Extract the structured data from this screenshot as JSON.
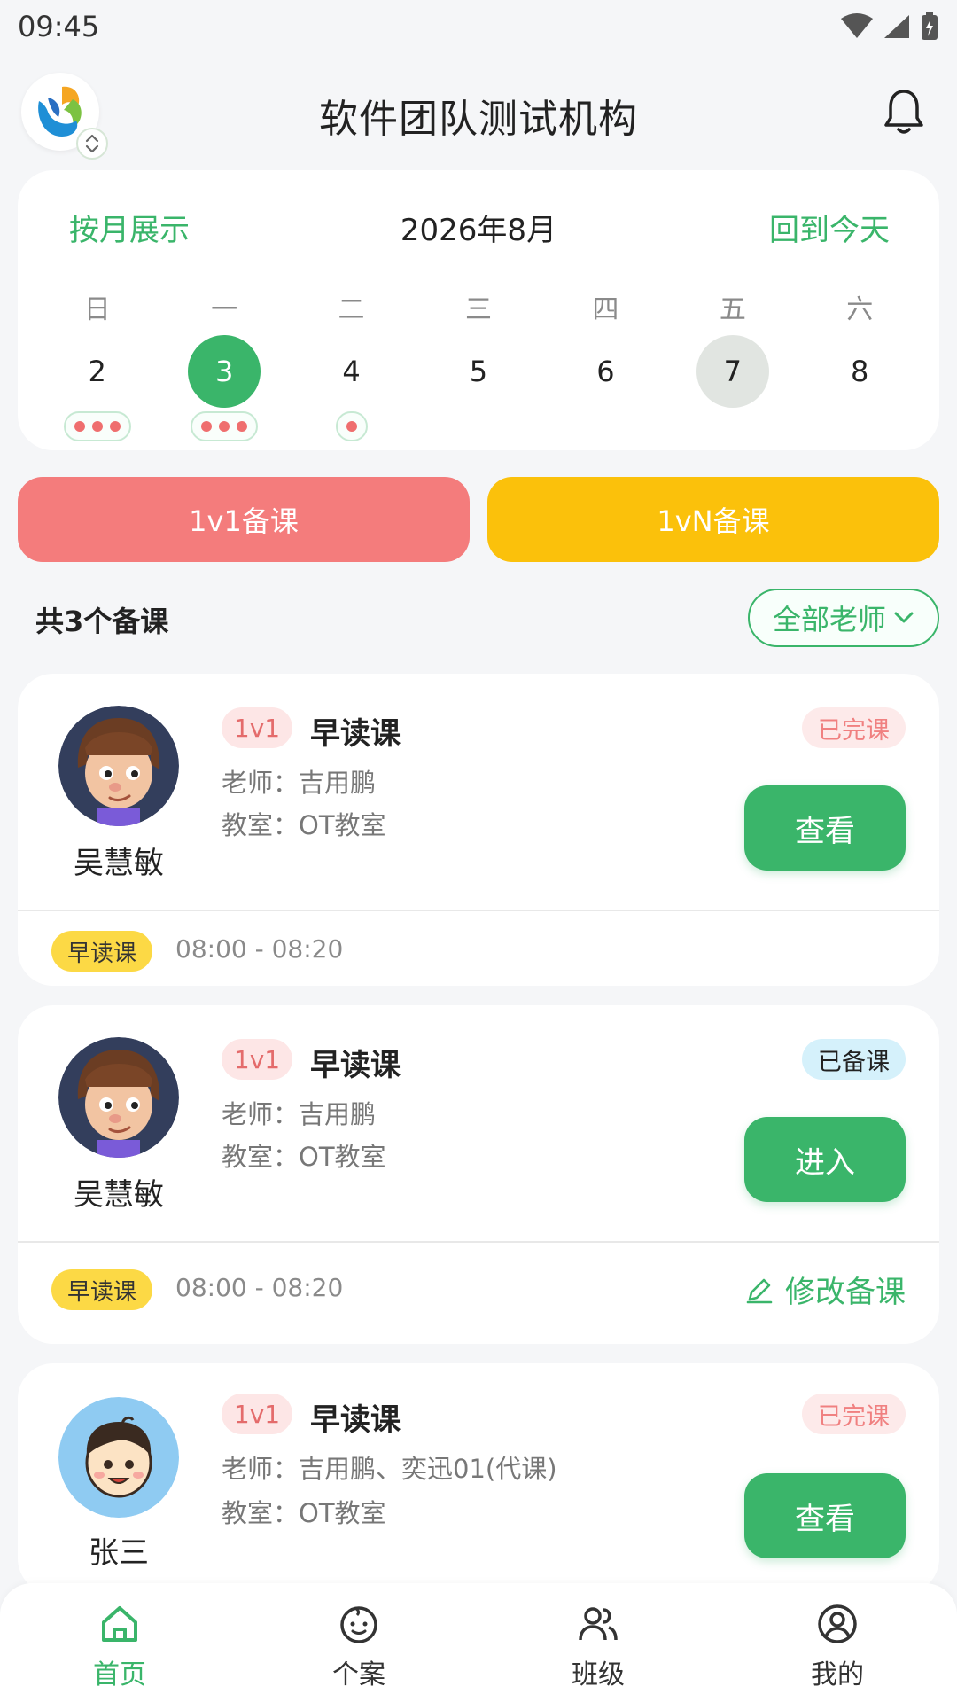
{
  "status_bar": {
    "time": "09:45"
  },
  "header": {
    "org_name": "软件团队测试机构"
  },
  "calendar": {
    "mode_label": "按月展示",
    "title": "2026年8月",
    "today_label": "回到今天",
    "days": [
      {
        "weekday": "日",
        "date": "2",
        "dot_count": 3,
        "state": ""
      },
      {
        "weekday": "一",
        "date": "3",
        "dot_count": 3,
        "state": "selected"
      },
      {
        "weekday": "二",
        "date": "4",
        "dot_count": 1,
        "state": ""
      },
      {
        "weekday": "三",
        "date": "5",
        "dot_count": 0,
        "state": ""
      },
      {
        "weekday": "四",
        "date": "6",
        "dot_count": 0,
        "state": ""
      },
      {
        "weekday": "五",
        "date": "7",
        "dot_count": 0,
        "state": "today"
      },
      {
        "weekday": "六",
        "date": "8",
        "dot_count": 0,
        "state": ""
      }
    ]
  },
  "prep_buttons": {
    "one_on_one": "1v1备课",
    "one_on_n": "1vN备课"
  },
  "summary": {
    "count_text": "共3个备课",
    "teacher_filter": "全部老师"
  },
  "lessons": [
    {
      "student": "吴慧敏",
      "avatar": "girl-cartoon",
      "type": "1v1",
      "course": "早读课",
      "teacher": "老师：吉用鹏",
      "room": "教室：OT教室",
      "status": "已完课",
      "action": "查看",
      "period": "早读课",
      "time": "08:00 - 08:20"
    },
    {
      "student": "吴慧敏",
      "avatar": "girl-cartoon",
      "type": "1v1",
      "course": "早读课",
      "teacher": "老师：吉用鹏",
      "room": "教室：OT教室",
      "status": "已备课",
      "action": "进入",
      "period": "早读课",
      "time": "08:00 - 08:20",
      "edit_label": "修改备课"
    },
    {
      "student": "张三",
      "avatar": "boy-cartoon",
      "type": "1v1",
      "course": "早读课",
      "teacher": "老师：吉用鹏、奕迅01(代课)",
      "room": "教室：OT教室",
      "status": "已完课",
      "action": "查看"
    }
  ],
  "nav": [
    {
      "label": "首页",
      "icon": "home-icon",
      "active": true
    },
    {
      "label": "个案",
      "icon": "baby-face-icon",
      "active": false
    },
    {
      "label": "班级",
      "icon": "users-icon",
      "active": false
    },
    {
      "label": "我的",
      "icon": "user-circle-icon",
      "active": false
    }
  ],
  "colors": {
    "accent": "#3ab56a",
    "one_on_one": "#f47c7c",
    "one_on_n": "#fbc10b",
    "period_tag": "#fcd945"
  }
}
